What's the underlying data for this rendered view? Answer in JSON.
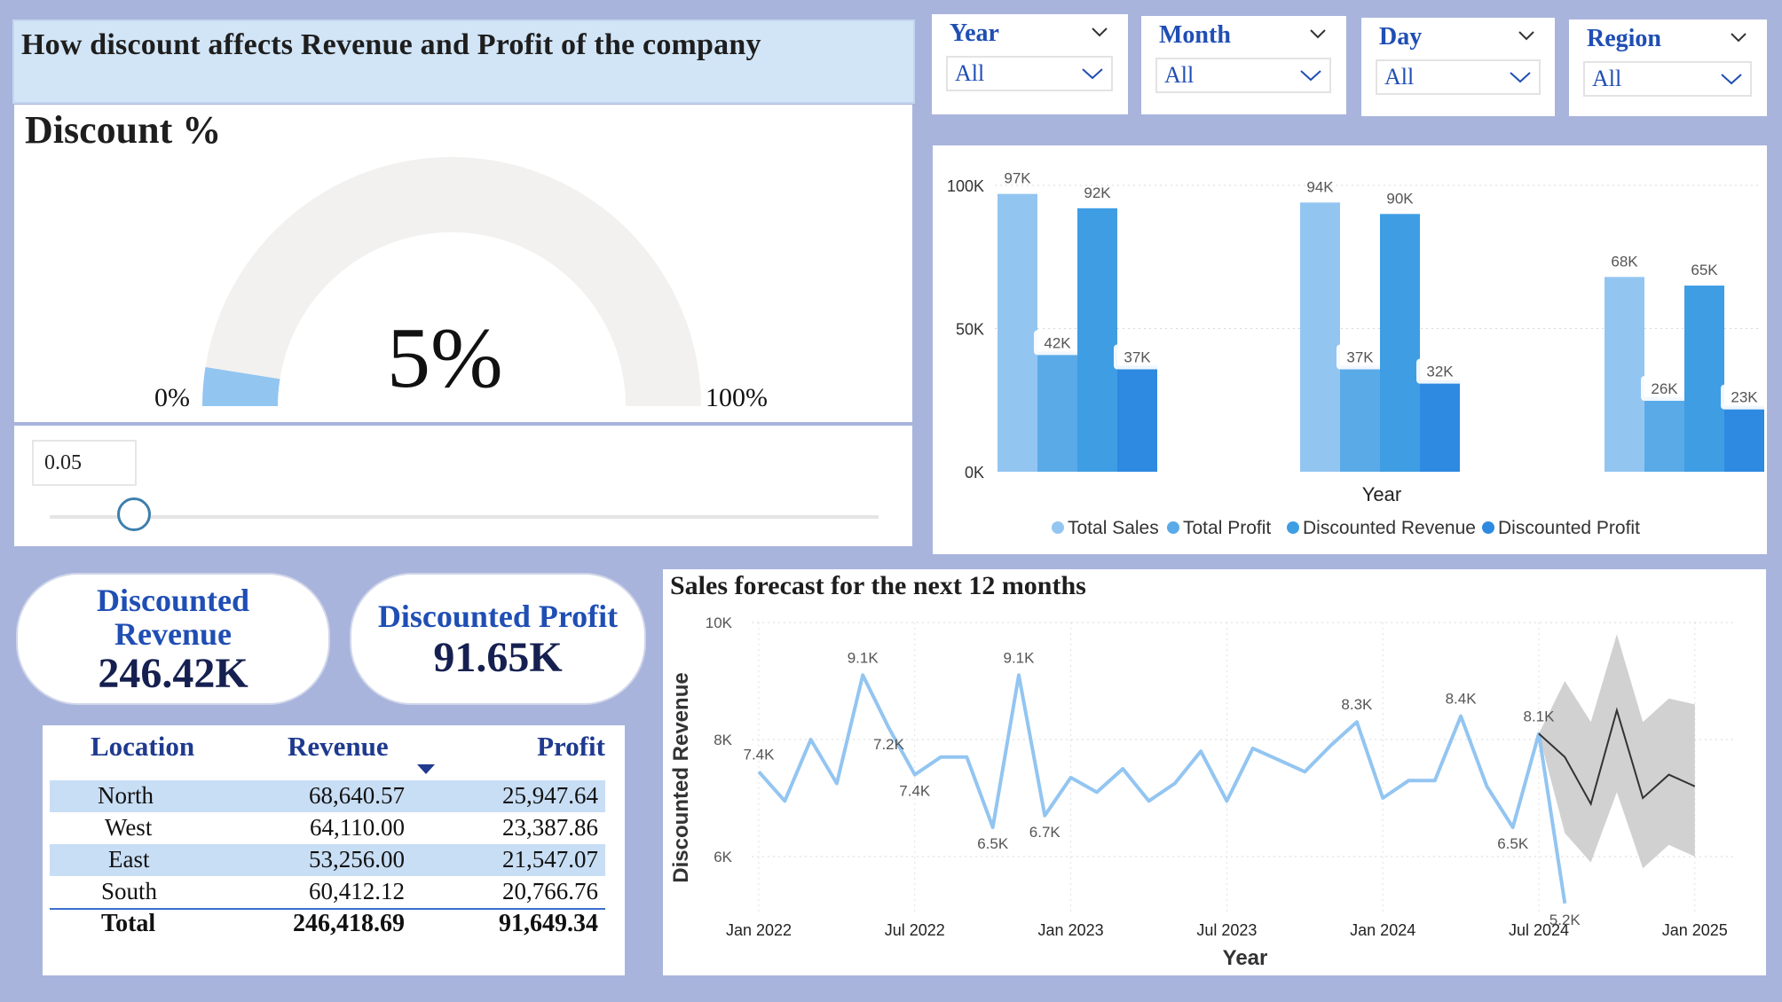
{
  "title": "How discount affects Revenue and Profit of the company",
  "gauge": {
    "label": "Discount %",
    "min_label": "0%",
    "max_label": "100%",
    "value_label": "5%",
    "value_fraction": 0.05,
    "track_color": "#f2f1f0",
    "fill_color": "#93c5f1"
  },
  "slider": {
    "input_value": "0.05",
    "value_fraction": 0.05
  },
  "filters": [
    {
      "name": "Year",
      "value": "All"
    },
    {
      "name": "Month",
      "value": "All"
    },
    {
      "name": "Day",
      "value": "All"
    },
    {
      "name": "Region",
      "value": "All"
    }
  ],
  "bar_chart": {
    "xlabel": "Year",
    "y_ticks": [
      "100K",
      "50K",
      "0K"
    ],
    "legend": [
      "Total Sales",
      "Total Profit",
      "Discounted Revenue",
      "Discounted Profit"
    ],
    "colors": [
      "#93c5f1",
      "#5aaae8",
      "#3f9de4",
      "#2e89e0"
    ]
  },
  "cards": {
    "revenue_title_1": "Discounted",
    "revenue_title_2": "Revenue",
    "revenue_value": "246.42K",
    "profit_title": "Discounted Profit",
    "profit_value": "91.65K"
  },
  "table": {
    "headers": [
      "Location",
      "Revenue",
      "Profit"
    ],
    "rows": [
      [
        "North",
        "68,640.57",
        "25,947.64"
      ],
      [
        "West",
        "64,110.00",
        "23,387.86"
      ],
      [
        "East",
        "53,256.00",
        "21,547.07"
      ],
      [
        "South",
        "60,412.12",
        "20,766.76"
      ]
    ],
    "total": [
      "Total",
      "246,418.69",
      "91,649.34"
    ]
  },
  "line_chart": {
    "title": "Sales forecast for the next 12 months",
    "ylabel": "Discounted Revenue",
    "xlabel": "Year",
    "y_ticks": [
      "10K",
      "8K",
      "6K"
    ],
    "x_ticks": [
      "Jan 2022",
      "Jul 2022",
      "Jan 2023",
      "Jul 2023",
      "Jan 2024",
      "Jul 2024",
      "Jan 2025"
    ],
    "line_color": "#93c5f1",
    "forecast_color": "#333333",
    "band_color": "#cccccc"
  },
  "chart_data": [
    {
      "type": "bar",
      "categories": [
        "",
        "",
        ""
      ],
      "xlabel": "Year",
      "ylim": [
        0,
        100000
      ],
      "legend_position": "bottom",
      "series": [
        {
          "name": "Total Sales",
          "values": [
            97000,
            94000,
            68000
          ],
          "labels": [
            "97K",
            "94K",
            "68K"
          ]
        },
        {
          "name": "Total Profit",
          "values": [
            42000,
            37000,
            26000
          ],
          "labels": [
            "42K",
            "37K",
            "26K"
          ]
        },
        {
          "name": "Discounted Revenue",
          "values": [
            92000,
            90000,
            65000
          ],
          "labels": [
            "92K",
            "90K",
            "65K"
          ]
        },
        {
          "name": "Discounted Profit",
          "values": [
            37000,
            32000,
            23000
          ],
          "labels": [
            "37K",
            "32K",
            "23K"
          ]
        }
      ]
    },
    {
      "type": "line",
      "title": "Sales forecast for the next 12 months",
      "xlabel": "Year",
      "ylabel": "Discounted Revenue",
      "ylim": [
        5000,
        10000
      ],
      "x_start": "Jan 2022",
      "x": [
        "Jan 2022",
        "Feb 2022",
        "Mar 2022",
        "Apr 2022",
        "May 2022",
        "Jun 2022",
        "Jul 2022",
        "Aug 2022",
        "Sep 2022",
        "Oct 2022",
        "Nov 2022",
        "Dec 2022",
        "Jan 2023",
        "Feb 2023",
        "Mar 2023",
        "Apr 2023",
        "May 2023",
        "Jun 2023",
        "Jul 2023",
        "Aug 2023",
        "Sep 2023",
        "Oct 2023",
        "Nov 2023",
        "Dec 2023",
        "Jan 2024",
        "Feb 2024",
        "Mar 2024",
        "Apr 2024",
        "May 2024",
        "Jun 2024",
        "Jul 2024",
        "Aug 2024"
      ],
      "series": [
        {
          "name": "Discounted Revenue",
          "values": [
            7450,
            6950,
            8000,
            7250,
            9100,
            8200,
            7400,
            7700,
            7700,
            6500,
            9100,
            6700,
            7350,
            7100,
            7500,
            6950,
            7250,
            7800,
            6950,
            7850,
            7650,
            7450,
            7900,
            8300,
            7000,
            7300,
            7300,
            8400,
            7200,
            6500,
            8100,
            5200
          ],
          "labels": {
            "0": "7.4K",
            "4": "9.1K",
            "5": "7.2K",
            "6": "7.4K",
            "9": "6.5K",
            "10": "9.1K",
            "11": "6.7K",
            "23": "8.3K",
            "27": "8.4K",
            "29": "6.5K",
            "30": "8.1K",
            "31": "5.2K"
          }
        },
        {
          "name": "Forecast",
          "start_index": 30,
          "values": [
            8100,
            7700,
            6900,
            8500,
            7000,
            7400,
            7200
          ],
          "upper": [
            8100,
            9000,
            8300,
            9800,
            8300,
            8700,
            8600
          ],
          "lower": [
            8100,
            6400,
            5900,
            7100,
            5800,
            6200,
            6000
          ]
        }
      ]
    }
  ]
}
